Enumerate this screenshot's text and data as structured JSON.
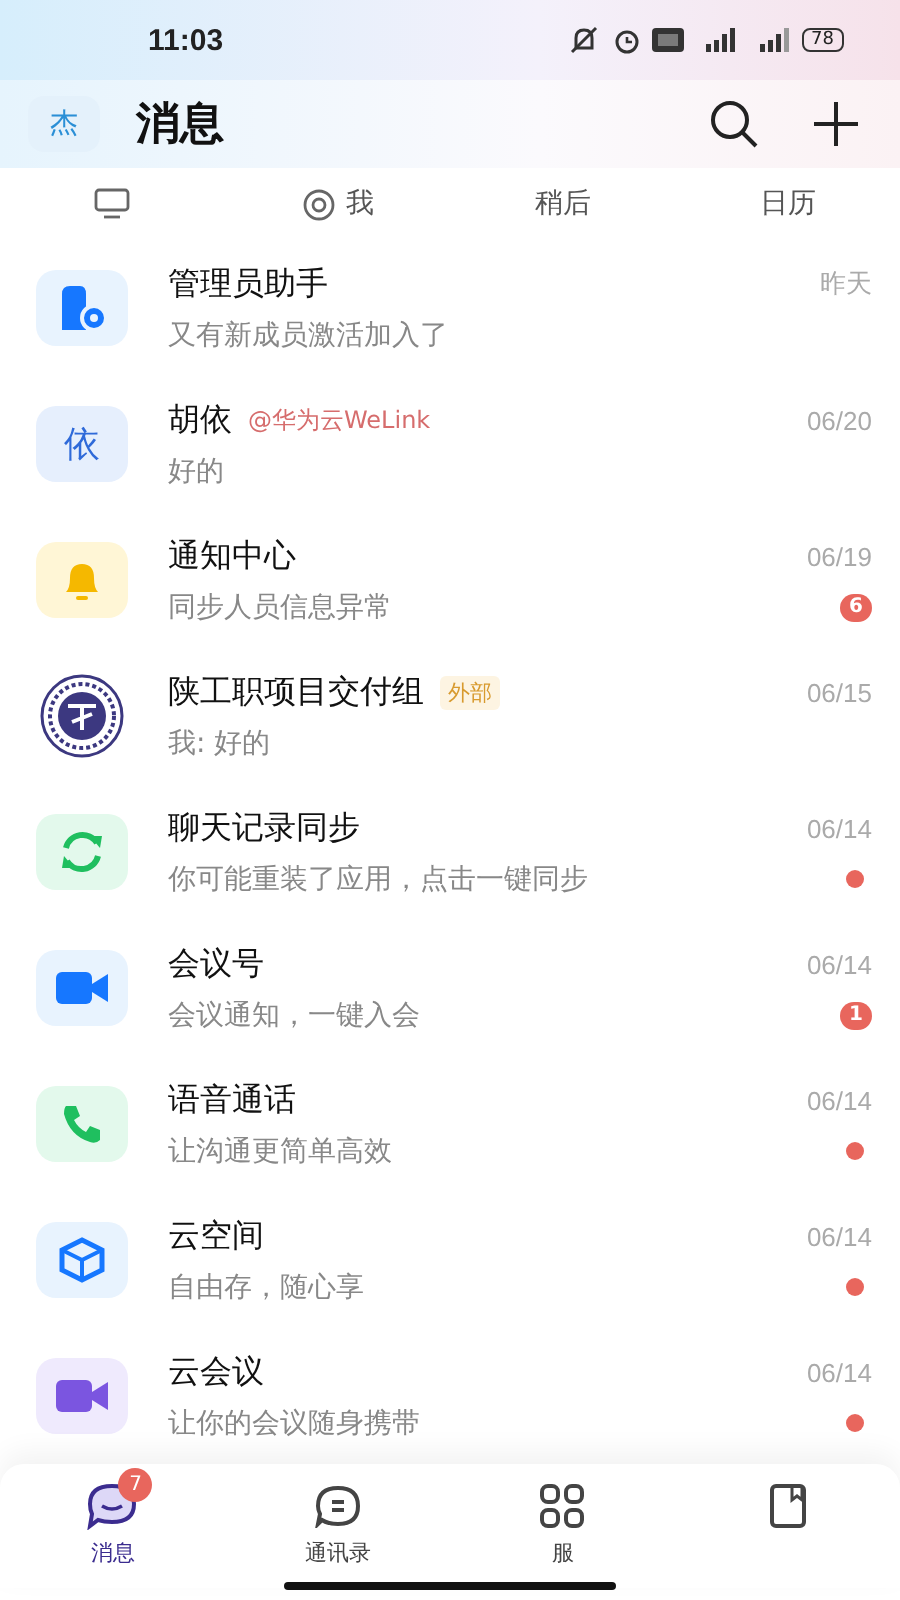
{
  "status_bar": {
    "time": "11:03",
    "battery": "78"
  },
  "header": {
    "avatar": "杰",
    "title": "消息"
  },
  "filters": [
    {
      "kind": "monitor"
    },
    {
      "kind": "mention",
      "label": "我"
    },
    {
      "kind": "text",
      "label": "稍后"
    },
    {
      "kind": "text",
      "label": "日历"
    }
  ],
  "conversations": [
    {
      "kind": "admin",
      "name": "管理员助手",
      "preview": "又有新成员激活加入了",
      "time": "昨天"
    },
    {
      "kind": "letter",
      "avatar": "依",
      "name": "胡依",
      "tag": {
        "kind": "mention",
        "text": "@华为云WeLink"
      },
      "preview": "好的",
      "time": "06/20"
    },
    {
      "kind": "bell",
      "name": "通知中心",
      "preview": "同步人员信息异常",
      "time": "06/19",
      "unread": {
        "kind": "count",
        "text": "6"
      }
    },
    {
      "kind": "emblem",
      "name": "陕工职项目交付组",
      "tag": {
        "kind": "external",
        "text": "外部"
      },
      "preview": "我: 好的",
      "time": "06/15"
    },
    {
      "kind": "sync",
      "name": "聊天记录同步",
      "preview": "你可能重装了应用，点击一键同步",
      "time": "06/14",
      "unread": {
        "kind": "dot"
      }
    },
    {
      "kind": "camera",
      "name": "会议号",
      "preview": "会议通知，一键入会",
      "time": "06/14",
      "unread": {
        "kind": "count",
        "text": "1"
      }
    },
    {
      "kind": "phone",
      "name": "语音通话",
      "preview": "让沟通更简单高效",
      "time": "06/14",
      "unread": {
        "kind": "dot"
      }
    },
    {
      "kind": "cube",
      "name": "云空间",
      "preview": "自由存，随心享",
      "time": "06/14",
      "unread": {
        "kind": "dot"
      }
    },
    {
      "kind": "camera_purple",
      "name": "云会议",
      "preview": "让你的会议随身携带",
      "time": "06/14",
      "unread": {
        "kind": "dot"
      }
    }
  ],
  "bottom_tabs": [
    {
      "kind": "chat",
      "label": "消息",
      "badge": "7",
      "selected": true
    },
    {
      "kind": "contacts",
      "label": "通讯录",
      "selected": false
    },
    {
      "kind": "apps",
      "label": "服",
      "selected": false
    },
    {
      "kind": "book",
      "selected": false
    }
  ]
}
